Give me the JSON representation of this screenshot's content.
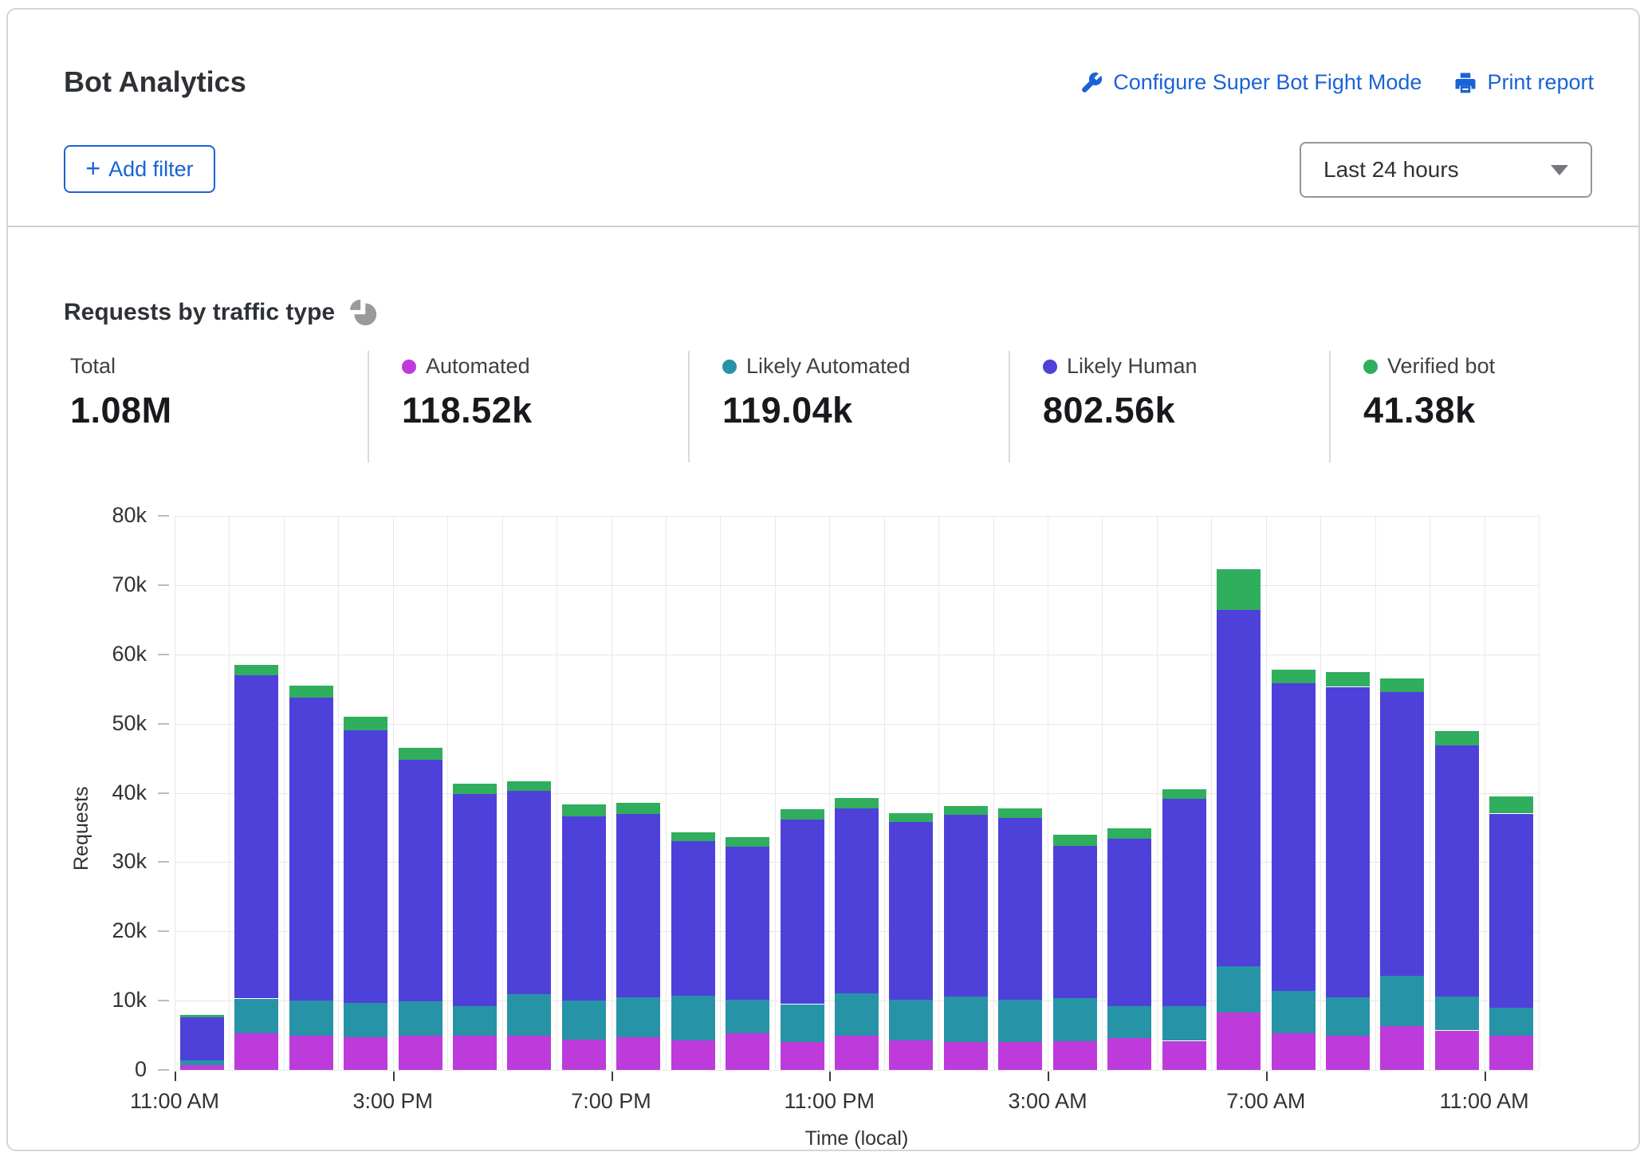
{
  "header": {
    "title": "Bot Analytics",
    "links": [
      {
        "label": "Configure Super Bot Fight Mode",
        "icon": "wrench-icon"
      },
      {
        "label": "Print report",
        "icon": "printer-icon"
      }
    ],
    "add_filter": {
      "plus": "+",
      "label": "Add filter"
    },
    "time_range": {
      "value": "Last 24 hours"
    }
  },
  "panel": {
    "title": "Requests by traffic type",
    "stats": [
      {
        "label": "Total",
        "value": "1.08M",
        "dot": null
      },
      {
        "label": "Automated",
        "value": "118.52k",
        "dot": "#bd3bdb"
      },
      {
        "label": "Likely Automated",
        "value": "119.04k",
        "dot": "#2793a7"
      },
      {
        "label": "Likely Human",
        "value": "802.56k",
        "dot": "#4e41da"
      },
      {
        "label": "Verified bot",
        "value": "41.38k",
        "dot": "#2fae5d"
      }
    ]
  },
  "chart_data": {
    "type": "bar",
    "stacked": true,
    "title": "Requests by traffic type",
    "xlabel": "Time (local)",
    "ylabel": "Requests",
    "unit": "thousands of requests per hour",
    "ylim": [
      0,
      80
    ],
    "ytick_step": 10,
    "ytick_labels": [
      "0",
      "10k",
      "20k",
      "30k",
      "40k",
      "50k",
      "60k",
      "70k",
      "80k"
    ],
    "x_tick_labels": [
      "11:00 AM",
      "3:00 PM",
      "7:00 PM",
      "11:00 PM",
      "3:00 AM",
      "7:00 AM",
      "11:00 AM"
    ],
    "x_tick_bar_positions": [
      0,
      4,
      8,
      12,
      16,
      20,
      24
    ],
    "n_bars": 25,
    "grid": true,
    "legend_position": "top-stats-row",
    "series": [
      {
        "name": "Automated",
        "color": "#bd3bdb",
        "values_k": [
          0.7,
          5.3,
          4.9,
          4.7,
          4.9,
          4.9,
          4.9,
          4.4,
          4.7,
          4.3,
          5.3,
          4.0,
          4.9,
          4.3,
          4.0,
          4.0,
          4.2,
          4.6,
          4.2,
          8.3,
          5.3,
          5.0,
          6.3,
          5.7,
          4.9
        ]
      },
      {
        "name": "Likely Automated",
        "color": "#2793a7",
        "values_k": [
          0.7,
          5.0,
          5.1,
          5.0,
          5.0,
          4.3,
          6.0,
          5.6,
          5.8,
          6.4,
          4.8,
          5.5,
          6.2,
          5.8,
          6.6,
          6.1,
          6.2,
          4.6,
          5.0,
          6.7,
          6.1,
          5.5,
          7.3,
          4.9,
          4.1
        ]
      },
      {
        "name": "Likely Human",
        "color": "#4e41da",
        "values_k": [
          6.2,
          46.7,
          43.8,
          39.3,
          34.9,
          30.6,
          29.4,
          26.6,
          26.4,
          22.3,
          22.1,
          26.6,
          26.7,
          25.7,
          26.2,
          26.3,
          21.9,
          24.2,
          29.9,
          51.4,
          44.4,
          44.8,
          41.0,
          36.2,
          28.0
        ]
      },
      {
        "name": "Verified bot",
        "color": "#2fae5d",
        "values_k": [
          0.4,
          1.5,
          1.7,
          2.0,
          1.7,
          1.5,
          1.4,
          1.7,
          1.7,
          1.3,
          1.4,
          1.5,
          1.4,
          1.3,
          1.3,
          1.4,
          1.7,
          1.5,
          1.4,
          5.9,
          2.0,
          2.1,
          1.9,
          2.1,
          2.5
        ]
      }
    ],
    "totals_k_note": "sums to ~1078k = 1.08M total"
  }
}
